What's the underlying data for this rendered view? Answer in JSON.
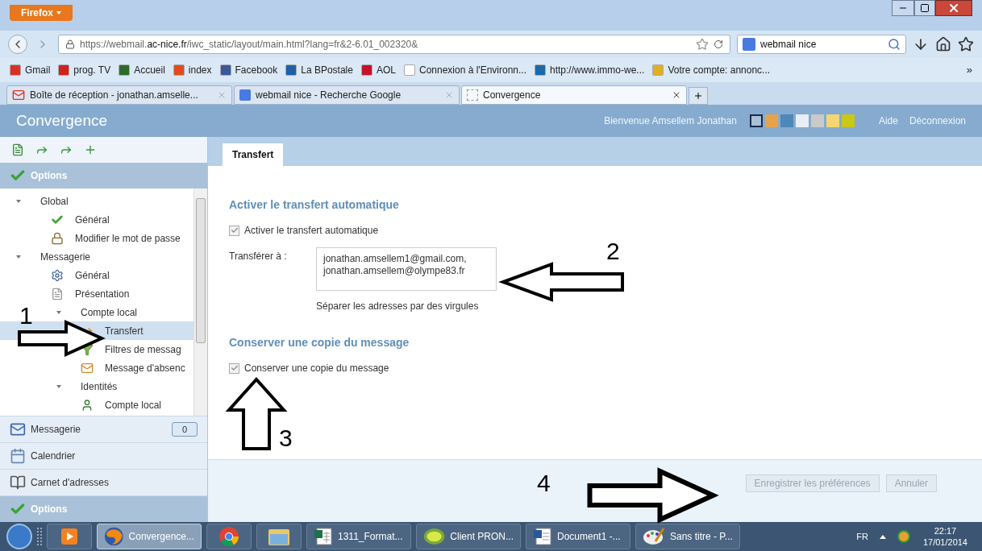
{
  "browser": {
    "menu_button": "Firefox",
    "url_parts": [
      {
        "text": "https://webmail.",
        "kind": "dim"
      },
      {
        "text": "ac-nice.fr",
        "kind": "host"
      },
      {
        "text": "/iwc_static/layout/main.html?lang=fr&2-6.01_002320&",
        "kind": "dim"
      }
    ],
    "search": {
      "value": "webmail nice"
    },
    "bookmarks": [
      {
        "label": "Gmail",
        "color": "#d93025"
      },
      {
        "label": "prog. TV",
        "color": "#d0211c"
      },
      {
        "label": "Accueil",
        "color": "#2d6b2a"
      },
      {
        "label": "index",
        "color": "#e34b1f"
      },
      {
        "label": "Facebook",
        "color": "#3b5998"
      },
      {
        "label": "La BPostale",
        "color": "#1f5fa8"
      },
      {
        "label": "AOL",
        "color": "#c8102e"
      },
      {
        "label": "Connexion à l'Environn...",
        "color": "#ffffff"
      },
      {
        "label": "http://www.immo-we...",
        "color": "#1a6aa8"
      },
      {
        "label": "Votre compte: annonc...",
        "color": "#e0b020"
      }
    ],
    "bookmarks_overflow": "»",
    "tabs": [
      {
        "label": "Boîte de réception - jonathan.amselle...",
        "selected": false,
        "kind": "gmail"
      },
      {
        "label": "webmail nice - Recherche Google",
        "selected": false,
        "kind": "google"
      },
      {
        "label": "Convergence",
        "selected": true,
        "kind": "page"
      }
    ]
  },
  "app": {
    "title": "Convergence",
    "welcome": "Bienvenue Amsellem Jonathan",
    "themes": [
      {
        "color": "#a9c0d6",
        "selected": true
      },
      {
        "color": "#e8a24c",
        "selected": false
      },
      {
        "color": "#4d88b8",
        "selected": false
      },
      {
        "color": "#e8eef5",
        "selected": false
      },
      {
        "color": "#cacaca",
        "selected": false
      },
      {
        "color": "#f6d670",
        "selected": false
      },
      {
        "color": "#c9c815",
        "selected": false
      }
    ],
    "links": [
      "Aide",
      "Déconnexion"
    ]
  },
  "sidebar": {
    "section": "Options",
    "tree": [
      {
        "label": "Global",
        "expanded": true,
        "children": [
          {
            "label": "Général",
            "kind": "check",
            "selected": false
          },
          {
            "label": "Modifier le mot de passe",
            "kind": "lock",
            "selected": false
          }
        ]
      },
      {
        "label": "Messagerie",
        "expanded": true,
        "children": [
          {
            "label": "Général",
            "kind": "settings",
            "selected": false
          },
          {
            "label": "Présentation",
            "kind": "page",
            "selected": false
          },
          {
            "label": "Compte local",
            "expanded": true,
            "children": [
              {
                "label": "Transfert",
                "kind": "forward",
                "selected": true
              },
              {
                "label": "Filtres de messag",
                "kind": "filter",
                "selected": false
              },
              {
                "label": "Message d'absenc",
                "kind": "absence",
                "selected": false
              }
            ]
          },
          {
            "label": "Identités",
            "expanded": true,
            "children": [
              {
                "label": "Compte local",
                "kind": "contact",
                "selected": false
              }
            ]
          }
        ]
      }
    ],
    "nav": [
      {
        "label": "Messagerie",
        "kind": "mail",
        "badge": "0",
        "selected": false
      },
      {
        "label": "Calendrier",
        "kind": "calendar",
        "selected": false
      },
      {
        "label": "Carnet d'adresses",
        "kind": "book",
        "selected": false
      },
      {
        "label": "Options",
        "kind": "options",
        "selected": true
      }
    ]
  },
  "main": {
    "tabs": [
      {
        "label": "Transfert",
        "selected": true
      }
    ],
    "sections": [
      {
        "heading": "Activer le transfert automatique",
        "checkbox": {
          "label": "Activer le transfert automatique",
          "checked": true
        },
        "field": {
          "label": "Transférer à :",
          "value": "jonathan.amsellem1@gmail.com,\njonathan.amsellem@olympe83.fr",
          "hint": "Séparer les adresses par des virgules"
        }
      },
      {
        "heading": "Conserver une copie du message",
        "checkbox": {
          "label": "Conserver une copie du message",
          "checked": true
        }
      }
    ],
    "buttons": [
      {
        "label": "Enregistrer les préférences",
        "disabled": true
      },
      {
        "label": "Annuler",
        "disabled": true
      }
    ]
  },
  "annotations": [
    {
      "label": "1",
      "kind": "right"
    },
    {
      "label": "2",
      "kind": "left"
    },
    {
      "label": "3",
      "kind": "up"
    },
    {
      "label": "4",
      "kind": "right"
    }
  ],
  "taskbar": {
    "items": [
      {
        "kind": "media",
        "selected": false
      },
      {
        "label": "Convergence...",
        "kind": "firefox",
        "selected": true
      },
      {
        "kind": "chrome",
        "selected": false
      },
      {
        "kind": "folder",
        "selected": false
      },
      {
        "label": "1311_Format...",
        "kind": "excel",
        "selected": false
      },
      {
        "label": "Client PRON...",
        "kind": "prn",
        "selected": false
      },
      {
        "label": "Document1 -...",
        "kind": "word",
        "selected": false
      },
      {
        "label": "Sans titre - P...",
        "kind": "paint",
        "selected": false
      }
    ],
    "language": "FR",
    "time": "22:17",
    "date": "17/01/2014"
  }
}
